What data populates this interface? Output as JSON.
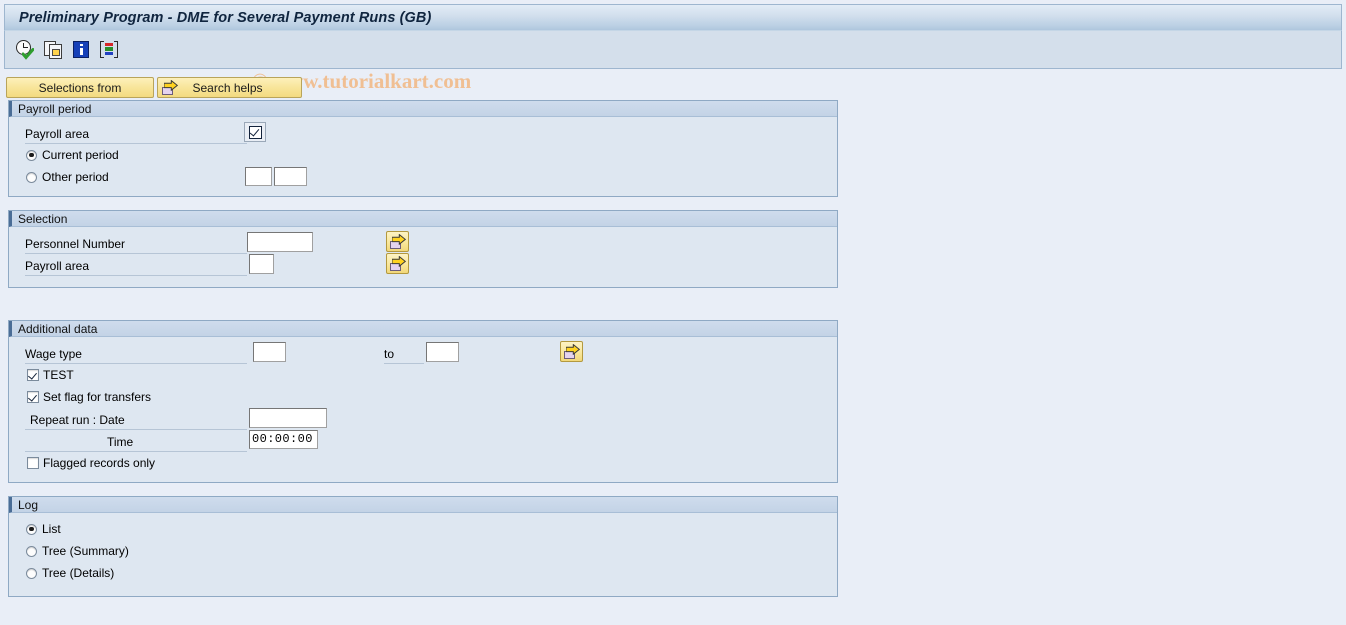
{
  "window": {
    "title": "Preliminary Program - DME for Several Payment Runs (GB)"
  },
  "watermark": {
    "text": "© www.tutorialkart.com",
    "color": "#f0bf93"
  },
  "toolbar": {
    "icons": [
      {
        "name": "execute-icon",
        "tooltip": "Execute"
      },
      {
        "name": "copy-variant-icon",
        "tooltip": "Get Variant"
      },
      {
        "name": "info-icon",
        "tooltip": "Information"
      },
      {
        "name": "color-variant-icon",
        "tooltip": "Variant"
      }
    ]
  },
  "buttons": {
    "selections_from": "Selections from",
    "search_helps": "Search helps"
  },
  "groups": {
    "payroll_period": {
      "title": "Payroll period",
      "payroll_area_label": "Payroll area",
      "payroll_area_value": "",
      "current_period_label": "Current period",
      "other_period_label": "Other period",
      "selected": "current",
      "other_period_value_1": "",
      "other_period_value_2": ""
    },
    "selection": {
      "title": "Selection",
      "personnel_number_label": "Personnel Number",
      "personnel_number_value": "",
      "payroll_area_label": "Payroll area",
      "payroll_area_value": ""
    },
    "additional_data": {
      "title": "Additional data",
      "wage_type_label": "Wage type",
      "wage_type_value": "",
      "to_label": "to",
      "wage_type_to_value": "",
      "test_label": "TEST",
      "test_checked": true,
      "set_flag_label": "Set flag for transfers",
      "set_flag_checked": true,
      "repeat_run_label": "Repeat run      : Date",
      "repeat_run_date_value": "",
      "time_label": "Time",
      "time_value": "00:00:00",
      "flagged_records_label": "Flagged records only",
      "flagged_records_checked": false
    },
    "log": {
      "title": "Log",
      "list_label": "List",
      "tree_summary_label": "Tree (Summary)",
      "tree_details_label": "Tree (Details)",
      "selected": "list"
    }
  }
}
